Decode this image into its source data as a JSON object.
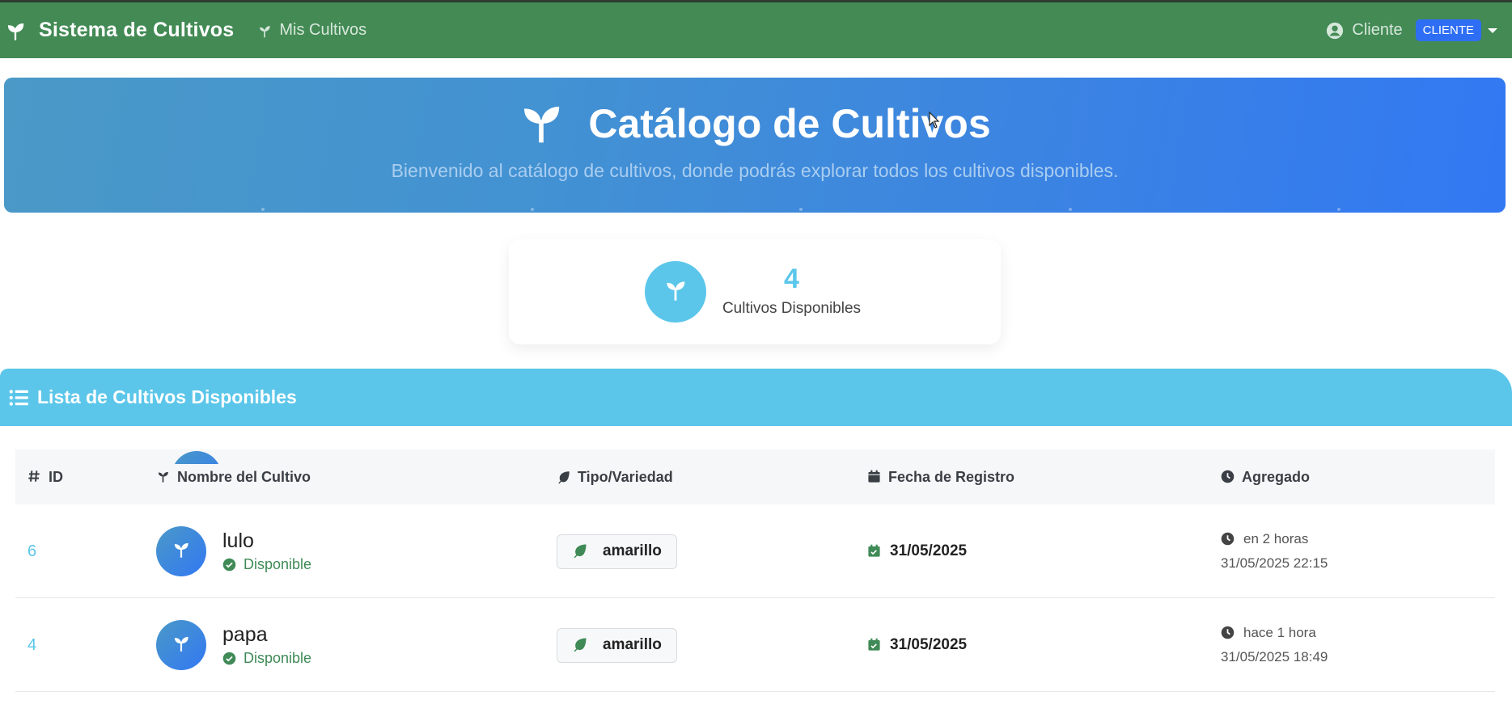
{
  "navbar": {
    "brand": "Sistema de Cultivos",
    "brand_icon": "seedling-icon",
    "nav_link": "Mis Cultivos",
    "nav_link_icon": "seedling-icon",
    "user_label": "Cliente",
    "user_icon": "user-circle-icon",
    "role_badge": "CLIENTE",
    "bg_color": "#438a55",
    "badge_color": "#2e6ef5"
  },
  "hero": {
    "title": "Catálogo de Cultivos",
    "subtitle": "Bienvenido al catálogo de cultivos, donde podrás explorar todos los cultivos disponibles.",
    "icon": "seedling-icon"
  },
  "stat": {
    "value": "4",
    "label": "Cultivos Disponibles",
    "icon": "seedling-icon",
    "accent": "#5bc6ea"
  },
  "list": {
    "title": "Lista de Cultivos Disponibles",
    "icon": "list-icon",
    "columns": [
      {
        "label": "ID",
        "icon": "hashtag-icon"
      },
      {
        "label": "Nombre del Cultivo",
        "icon": "seedling-icon"
      },
      {
        "label": "Tipo/Variedad",
        "icon": "leaf-icon"
      },
      {
        "label": "Fecha de Registro",
        "icon": "calendar-icon"
      },
      {
        "label": "Agregado",
        "icon": "clock-icon"
      }
    ],
    "rows": [
      {
        "id": "6",
        "name": "lulo",
        "status": "Disponible",
        "variety": "amarillo",
        "date": "31/05/2025",
        "added_relative": "en 2 horas",
        "added_exact": "31/05/2025 22:15"
      },
      {
        "id": "4",
        "name": "papa",
        "status": "Disponible",
        "variety": "amarillo",
        "date": "31/05/2025",
        "added_relative": "hace 1 hora",
        "added_exact": "31/05/2025 18:49"
      }
    ]
  }
}
